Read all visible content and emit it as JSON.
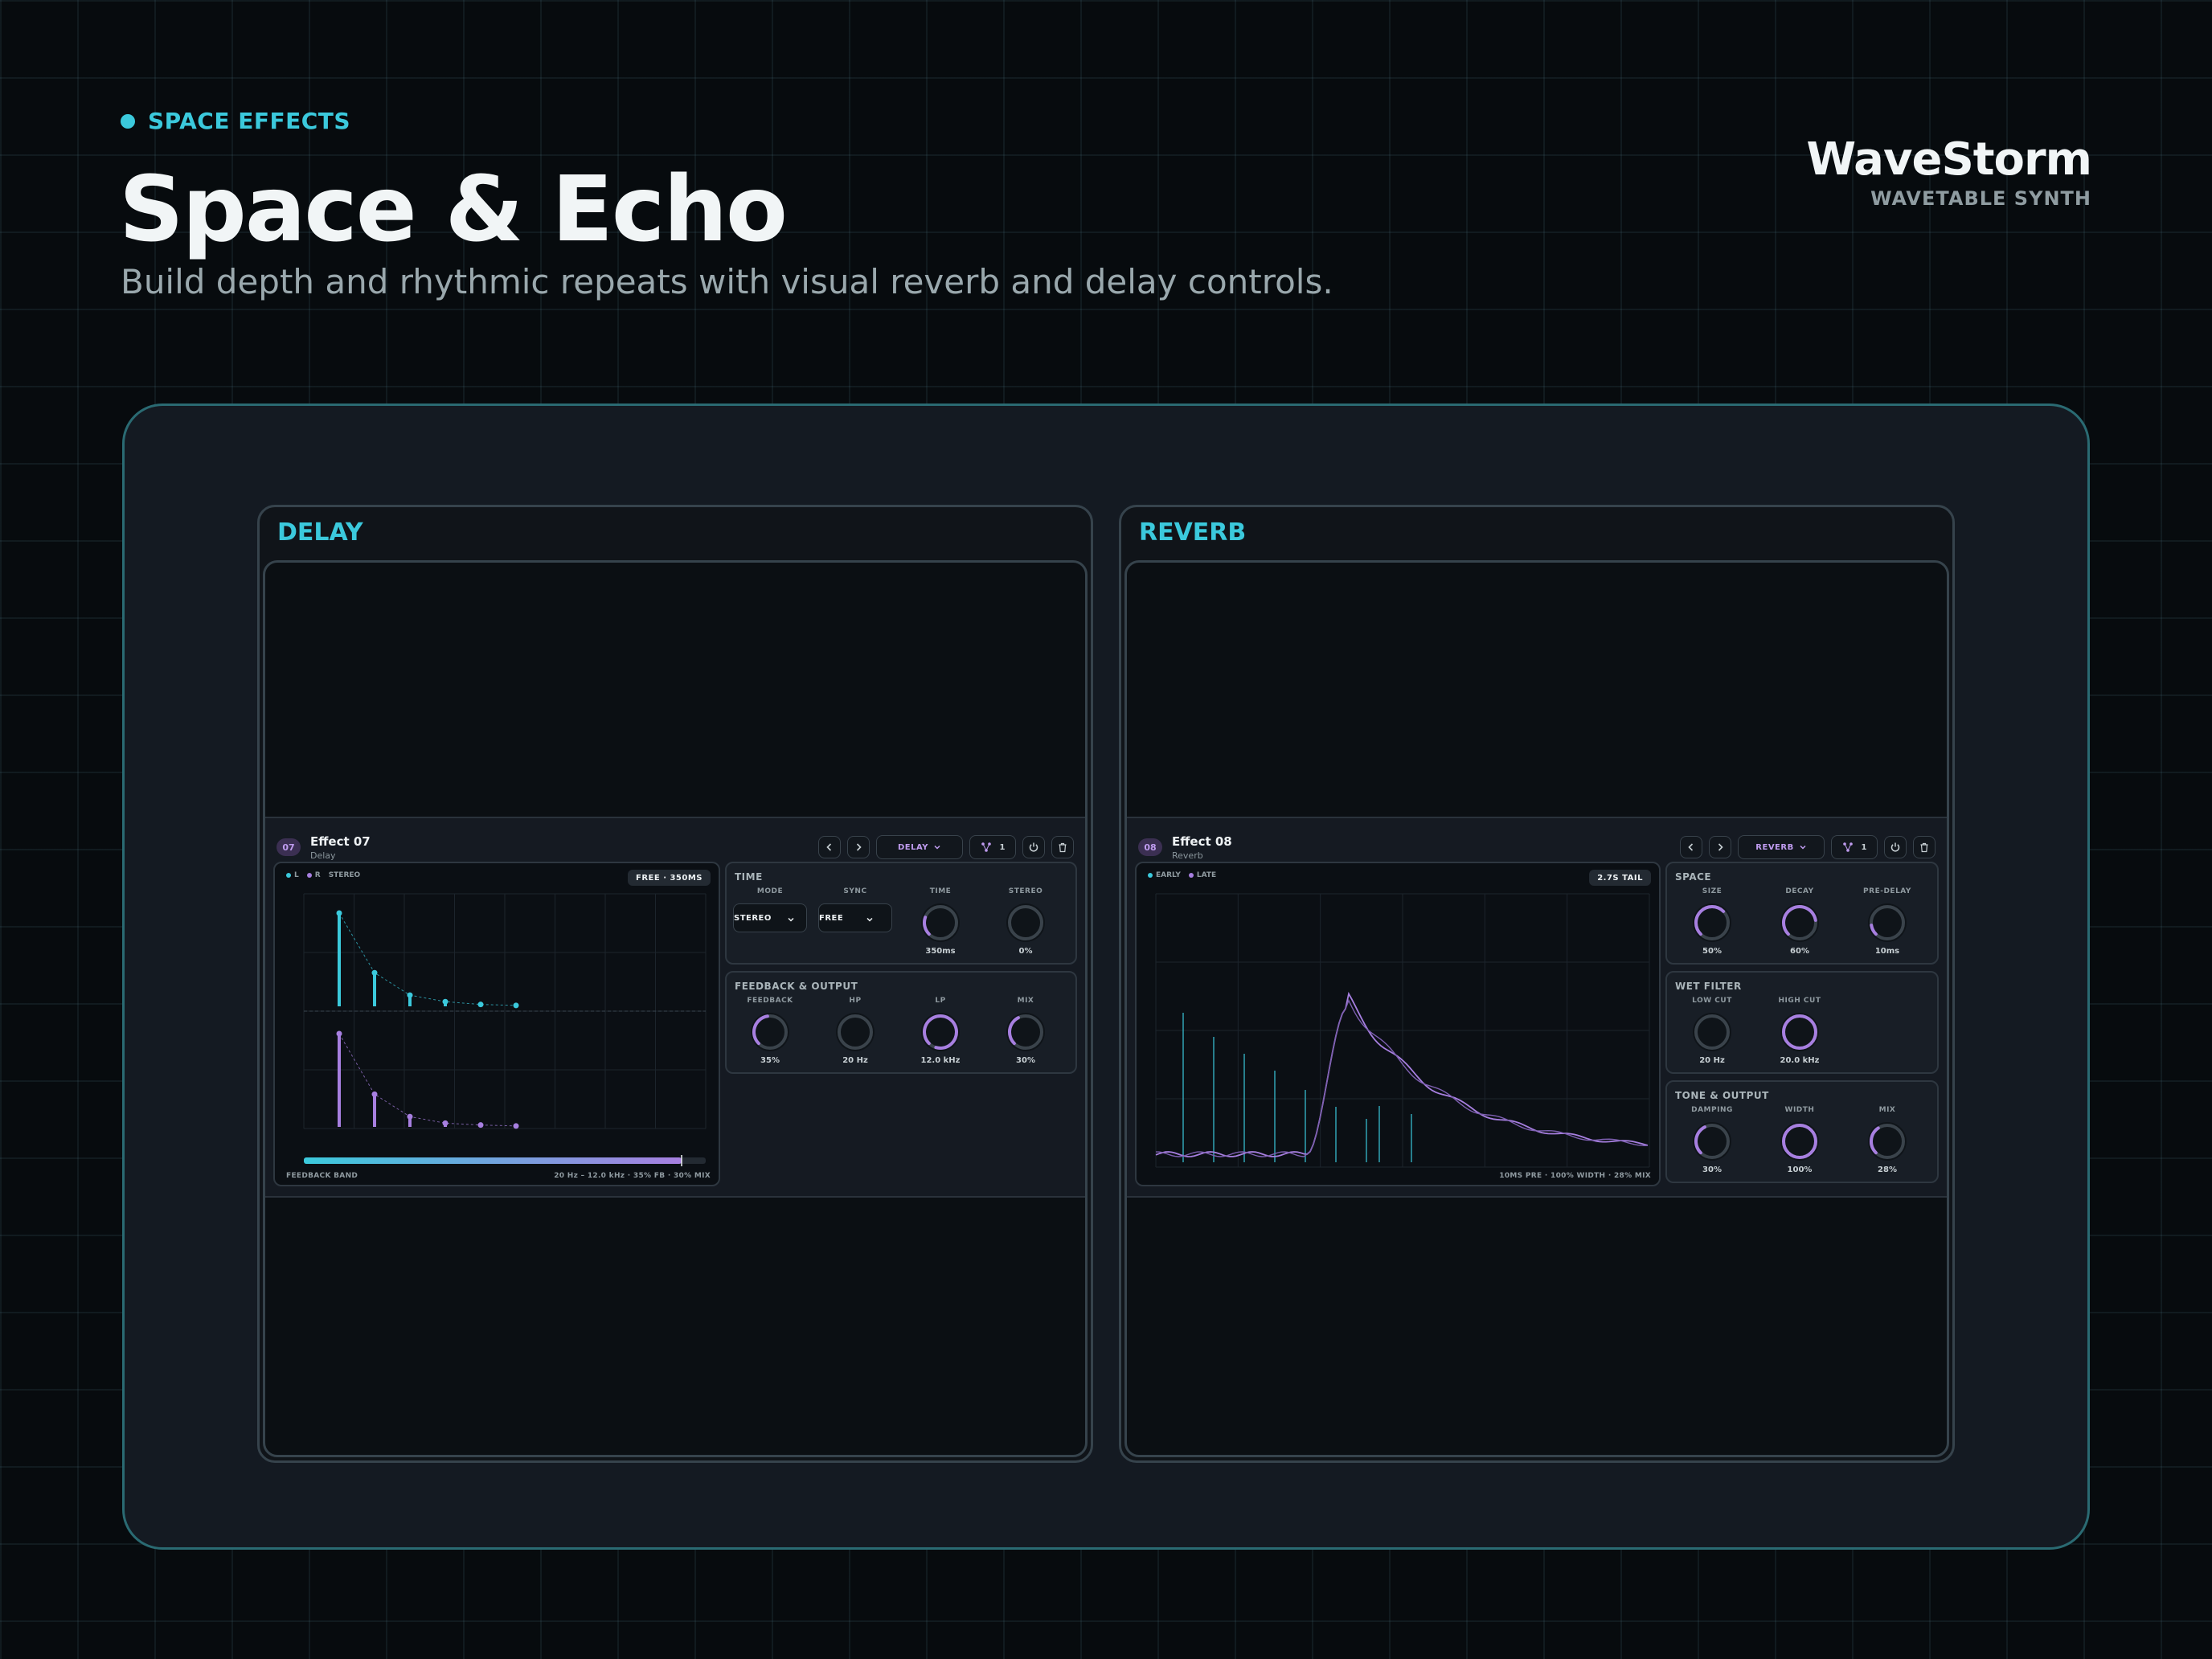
{
  "header": {
    "badge": "SPACE EFFECTS",
    "title": "Space & Echo",
    "subtitle": "Build depth and rhythmic repeats with visual reverb and delay controls.",
    "brand_name": "WaveStorm",
    "brand_tag": "WAVETABLE SYNTH"
  },
  "delay": {
    "window_title": "DELAY",
    "number": "07",
    "name": "Effect 07",
    "type": "Delay",
    "type_select": "DELAY",
    "route_count": "1",
    "legend": [
      "L",
      "R",
      "STEREO"
    ],
    "pill": "FREE · 350MS",
    "feedback_band_label": "FEEDBACK BAND",
    "summary": "20 Hz – 12.0 kHz · 35% FB · 30% MIX",
    "feedback_band_fill": 0.94,
    "taps_l": [
      1.0,
      0.36,
      0.12,
      0.05,
      0.02,
      0.01
    ],
    "taps_r": [
      1.0,
      0.35,
      0.11,
      0.04,
      0.02,
      0.01
    ],
    "panels": {
      "time": {
        "title": "TIME",
        "mode": {
          "label": "MODE",
          "value": "STEREO"
        },
        "sync": {
          "label": "SYNC",
          "value": "FREE"
        },
        "time": {
          "label": "TIME",
          "value": "350ms",
          "level": 0.18
        },
        "stereo": {
          "label": "STEREO",
          "value": "0%",
          "level": 0
        }
      },
      "feedback": {
        "title": "FEEDBACK & OUTPUT",
        "feedback": {
          "label": "FEEDBACK",
          "value": "35%",
          "level": 0.35
        },
        "hp": {
          "label": "HP",
          "value": "20 Hz",
          "level": 0
        },
        "lp": {
          "label": "LP",
          "value": "12.0 kHz",
          "level": 0.92
        },
        "mix": {
          "label": "MIX",
          "value": "30%",
          "level": 0.3
        }
      }
    }
  },
  "reverb": {
    "window_title": "REVERB",
    "number": "08",
    "name": "Effect 08",
    "type": "Reverb",
    "type_select": "REVERB",
    "route_count": "1",
    "legend": [
      "EARLY",
      "LATE"
    ],
    "pill": "2.7S TAIL",
    "summary": "10MS PRE · 100% WIDTH · 28% MIX",
    "early_reflections": [
      0.62,
      0.52,
      0.45,
      0.38,
      0.3,
      0.23,
      0.18
    ],
    "panels": {
      "space": {
        "title": "SPACE",
        "size": {
          "label": "SIZE",
          "value": "50%",
          "level": 0.5
        },
        "decay": {
          "label": "DECAY",
          "value": "60%",
          "level": 0.6
        },
        "predelay": {
          "label": "PRE-DELAY",
          "value": "10ms",
          "level": 0.1
        }
      },
      "wet_filter": {
        "title": "WET FILTER",
        "low_cut": {
          "label": "LOW CUT",
          "value": "20 Hz",
          "level": 0
        },
        "high_cut": {
          "label": "HIGH CUT",
          "value": "20.0 kHz",
          "level": 1.0
        }
      },
      "tone": {
        "title": "TONE & OUTPUT",
        "damping": {
          "label": "DAMPING",
          "value": "30%",
          "level": 0.3
        },
        "width": {
          "label": "WIDTH",
          "value": "100%",
          "level": 1.0
        },
        "mix": {
          "label": "MIX",
          "value": "28%",
          "level": 0.28
        }
      }
    }
  },
  "colors": {
    "accent_cyan": "#3bc9dc",
    "accent_purple": "#a77fe0",
    "knob_track": "#3a434b"
  },
  "icons": {
    "prev": "chevron-left-icon",
    "next": "chevron-right-icon",
    "dropdown": "chevron-down-icon",
    "route": "route-icon",
    "power": "power-icon",
    "delete": "trash-icon"
  }
}
